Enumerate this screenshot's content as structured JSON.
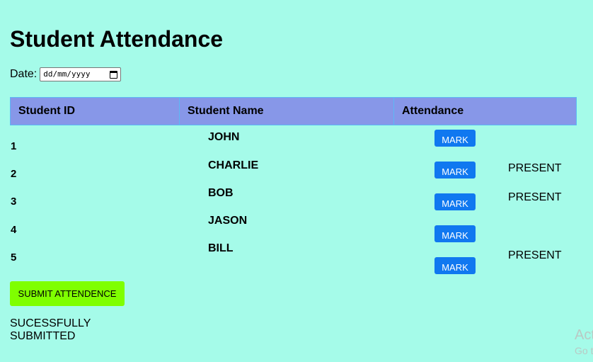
{
  "page": {
    "title": "Student Attendance",
    "date_label": "Date:",
    "date_placeholder": "dd/mm/yyyy"
  },
  "table": {
    "headers": [
      "Student ID",
      "Student Name",
      "Attendance"
    ],
    "rows": [
      {
        "id": "1",
        "name": "JOHN",
        "status": ""
      },
      {
        "id": "2",
        "name": "CHARLIE",
        "status": "PRESENT"
      },
      {
        "id": "3",
        "name": "BOB",
        "status": "PRESENT"
      },
      {
        "id": "4",
        "name": "JASON",
        "status": ""
      },
      {
        "id": "5",
        "name": "BILL",
        "status": "PRESENT"
      }
    ],
    "mark_label": "MARK"
  },
  "actions": {
    "submit_label": "SUBMIT ATTENDENCE",
    "result_text": "SUCESSFULLY SUBMITTED"
  },
  "watermark": {
    "line1": "Act",
    "line2": "Go t"
  },
  "colors": {
    "background": "#a5fbe9",
    "header": "#8797e8",
    "mark_button": "#1078f0",
    "submit_button": "#7fff00"
  },
  "icons": {
    "date_picker": "calendar-icon"
  }
}
